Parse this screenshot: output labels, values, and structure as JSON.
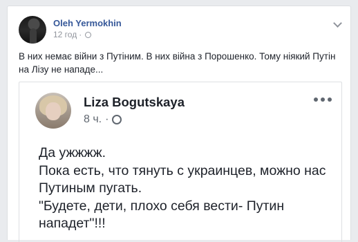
{
  "post": {
    "author": "Oleh Yermokhin",
    "time": "12 год",
    "separator": "·",
    "text": "В них немає війни з Путіним. В них війна з Порошенко. Тому ніякий Путін на Лізу не нападе..."
  },
  "shared_post": {
    "author": "Liza Bogutskaya",
    "time": "8 ч.",
    "separator": "·",
    "text": "Да ужжжж.\nПока есть, что тянуть с украинцев, можно нас Путиным пугать.\n\"Будете, дети, плохо себя вести- Путин нападет\"!!!"
  },
  "icons": {
    "privacy": "globe-icon",
    "options": "chevron-down-icon",
    "more": "more-dots-icon"
  }
}
